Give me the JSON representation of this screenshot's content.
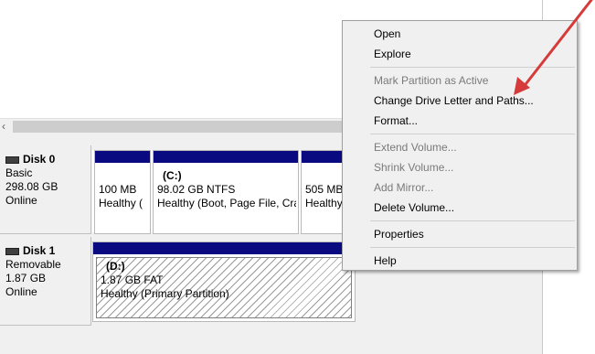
{
  "disks": [
    {
      "name": "Disk 0",
      "type": "Basic",
      "size": "298.08 GB",
      "status": "Online",
      "partitions": [
        {
          "label": "",
          "size_fs": "100 MB",
          "status": "Healthy ("
        },
        {
          "label": "(C:)",
          "size_fs": "98.02 GB NTFS",
          "status": "Healthy (Boot, Page File, Cra"
        },
        {
          "label": "",
          "size_fs": "505 MB",
          "status": "Healthy"
        }
      ]
    },
    {
      "name": "Disk 1",
      "type": "Removable",
      "size": "1.87 GB",
      "status": "Online",
      "partitions": [
        {
          "label": "(D:)",
          "size_fs": "1.87 GB FAT",
          "status": "Healthy (Primary Partition)"
        }
      ]
    }
  ],
  "context_menu": {
    "items": [
      {
        "label": "Open",
        "enabled": true
      },
      {
        "label": "Explore",
        "enabled": true
      },
      {
        "label": "Mark Partition as Active",
        "enabled": false
      },
      {
        "label": "Change Drive Letter and Paths...",
        "enabled": true
      },
      {
        "label": "Format...",
        "enabled": true
      },
      {
        "label": "Extend Volume...",
        "enabled": false
      },
      {
        "label": "Shrink Volume...",
        "enabled": false
      },
      {
        "label": "Add Mirror...",
        "enabled": false
      },
      {
        "label": "Delete Volume...",
        "enabled": true
      },
      {
        "label": "Properties",
        "enabled": true
      },
      {
        "label": "Help",
        "enabled": true
      }
    ]
  },
  "colors": {
    "partition_bar": "#0a0a80",
    "annotation_arrow": "#d63a3a"
  },
  "icons": {
    "scroll_left": "‹"
  }
}
